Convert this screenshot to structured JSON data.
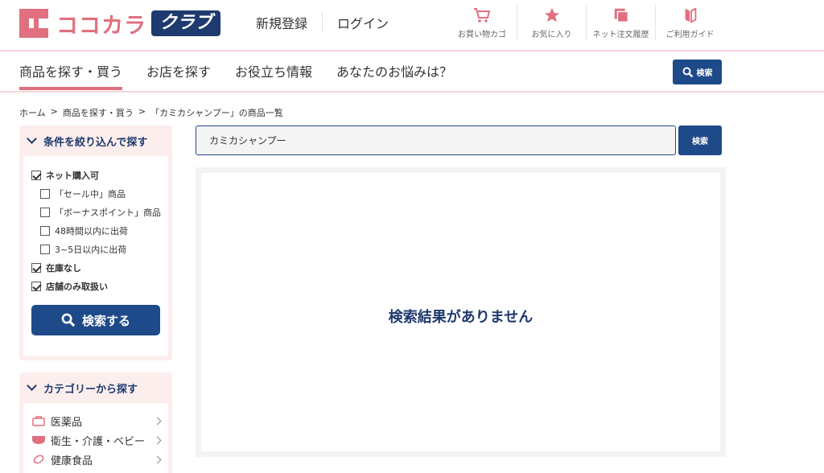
{
  "header": {
    "logo_text": "ココカラ",
    "logo_badge": "クラブ",
    "register": "新規登録",
    "login": "ログイン",
    "utilities": [
      {
        "icon": "cart-icon",
        "label": "お買い物カゴ"
      },
      {
        "icon": "star-icon",
        "label": "お気に入り"
      },
      {
        "icon": "order-history-icon",
        "label": "ネット注文履歴"
      },
      {
        "icon": "guide-book-icon",
        "label": "ご利用ガイド"
      }
    ],
    "accent_color": "#e0707f",
    "brand_color": "#1f4a8a"
  },
  "nav": {
    "items": [
      "商品を探す・買う",
      "お店を探す",
      "お役立ち情報",
      "あなたのお悩みは？"
    ],
    "active_index": 0,
    "search_label": "検索"
  },
  "breadcrumb": [
    "ホーム",
    ">",
    "商品を探す・買う",
    ">",
    "「カミカシャンプー」の商品一覧"
  ],
  "filter": {
    "title": "条件を絞り込んで探す",
    "options": [
      {
        "label": "ネット購入可",
        "checked": true,
        "level": 1
      },
      {
        "label": "「セール中」商品",
        "checked": false,
        "level": 2
      },
      {
        "label": "「ボーナスポイント」商品",
        "checked": false,
        "level": 2
      },
      {
        "label": "48時間以内に出荷",
        "checked": false,
        "level": 2
      },
      {
        "label": "3~5日以内に出荷",
        "checked": false,
        "level": 2
      },
      {
        "label": "在庫なし",
        "checked": true,
        "level": 1
      },
      {
        "label": "店舗のみ取扱い",
        "checked": true,
        "level": 1
      }
    ],
    "search_button": "検索する"
  },
  "categories": {
    "title": "カテゴリーから探す",
    "items": [
      {
        "icon": "medicine-bag-icon",
        "label": "医薬品"
      },
      {
        "icon": "diaper-icon",
        "label": "衛生・介護・ベビー"
      },
      {
        "icon": "supplement-icon",
        "label": "健康食品"
      }
    ]
  },
  "search": {
    "query": "カミカシャンプー",
    "button": "検索"
  },
  "results": {
    "empty_message": "検索結果がありません"
  }
}
